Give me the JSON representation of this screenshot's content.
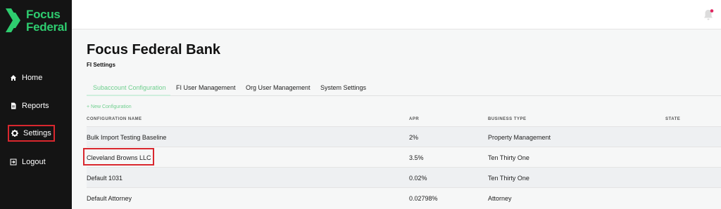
{
  "brand": {
    "line1": "Focus",
    "line2": "Federal",
    "color": "#2ecc6f"
  },
  "sidebar": {
    "items": [
      {
        "label": "Home",
        "icon": "home-icon"
      },
      {
        "label": "Reports",
        "icon": "document-icon"
      },
      {
        "label": "Settings",
        "icon": "gear-icon",
        "active": true,
        "highlight_color": "#d9272e"
      },
      {
        "label": "Logout",
        "icon": "logout-icon"
      }
    ]
  },
  "topbar": {
    "notification_icon": "bell-icon",
    "notification_dot_color": "#e0245e"
  },
  "page": {
    "title": "Focus Federal Bank",
    "subtitle": "FI Settings"
  },
  "tabs": [
    {
      "label": "Subaccount Configuration",
      "active": true
    },
    {
      "label": "FI User Management"
    },
    {
      "label": "Org User Management"
    },
    {
      "label": "System Settings"
    }
  ],
  "actions": {
    "new_configuration": "+ New Configuration"
  },
  "table": {
    "headers": [
      "CONFIGURATION NAME",
      "APR",
      "BUSINESS TYPE",
      "STATE"
    ],
    "rows": [
      {
        "name": "Bulk Import Testing Baseline",
        "apr": "2%",
        "business_type": "Property Management",
        "state": ""
      },
      {
        "name": "Cleveland Browns LLC",
        "apr": "3.5%",
        "business_type": "Ten Thirty One",
        "state": "",
        "highlighted": true
      },
      {
        "name": "Default 1031",
        "apr": "0.02%",
        "business_type": "Ten Thirty One",
        "state": ""
      },
      {
        "name": "Default Attorney",
        "apr": "0.02798%",
        "business_type": "Attorney",
        "state": ""
      }
    ]
  },
  "colors": {
    "accent_green": "#6fcf8e",
    "sidebar_bg": "#141414",
    "highlight_red": "#d9272e"
  }
}
